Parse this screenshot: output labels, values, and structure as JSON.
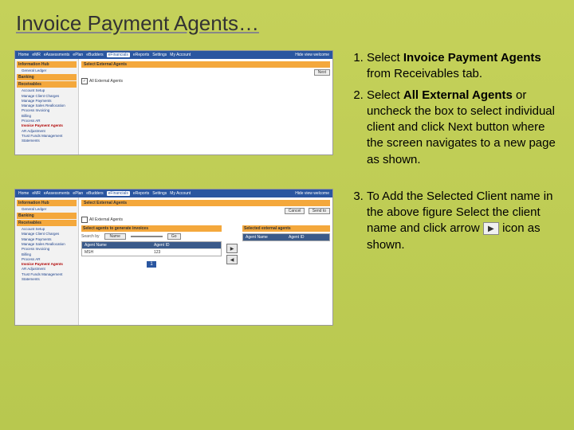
{
  "title": "Invoice Payment Agents…",
  "nav": {
    "items": [
      "Home",
      "eMR",
      "eAssessments",
      "ePlan",
      "eBudders",
      "eFinancials",
      "eReports",
      "Settings",
      "My Account"
    ],
    "active": "eFinancials",
    "welcome": "Hide  view  welcome"
  },
  "sidebar1": {
    "h1": "Information Hub",
    "i1": "General Ledger",
    "h2": "Banking",
    "h3": "Receivables",
    "items1": [
      "Account Setup",
      "Manage Client Charges",
      "Manage Payments",
      "Manage Sales Reallocation",
      "Process Invoicing",
      "Billing",
      "Process AR",
      "Invoice Payment Agents",
      "AR Adjustment",
      "Trust Funds Management",
      "Statements"
    ]
  },
  "panel1": {
    "title": "Select External Agents",
    "checkbox": "All External Agents",
    "next": "Next"
  },
  "panel2": {
    "title": "Select External Agents",
    "subtitle": "Select agents to generate invoices",
    "rightTitle": "Selected external agents",
    "cancel": "Cancel",
    "sendto": "Send to",
    "searchLabel": "Search by",
    "searchOpt": "Name",
    "go": "Go",
    "leftHeader1": "Agent Name",
    "leftHeader2": "Agent ID",
    "rightHeader1": "Agent Name",
    "rightHeader2": "Agent ID",
    "row1a": "MSH",
    "row1b": "123",
    "page": "1"
  },
  "steps": {
    "s1a": "Select ",
    "s1b": "Invoice Payment Agents",
    "s1c": " from Receivables tab.",
    "s2a": "Select ",
    "s2b": "All External Agents",
    "s2c": " or  uncheck the box to select individual client and click Next button where the screen navigates to a new page as shown.",
    "s3a": "To Add the Selected Client name in the above figure Select the client name and click arrow ",
    "s3b": " icon as shown."
  }
}
